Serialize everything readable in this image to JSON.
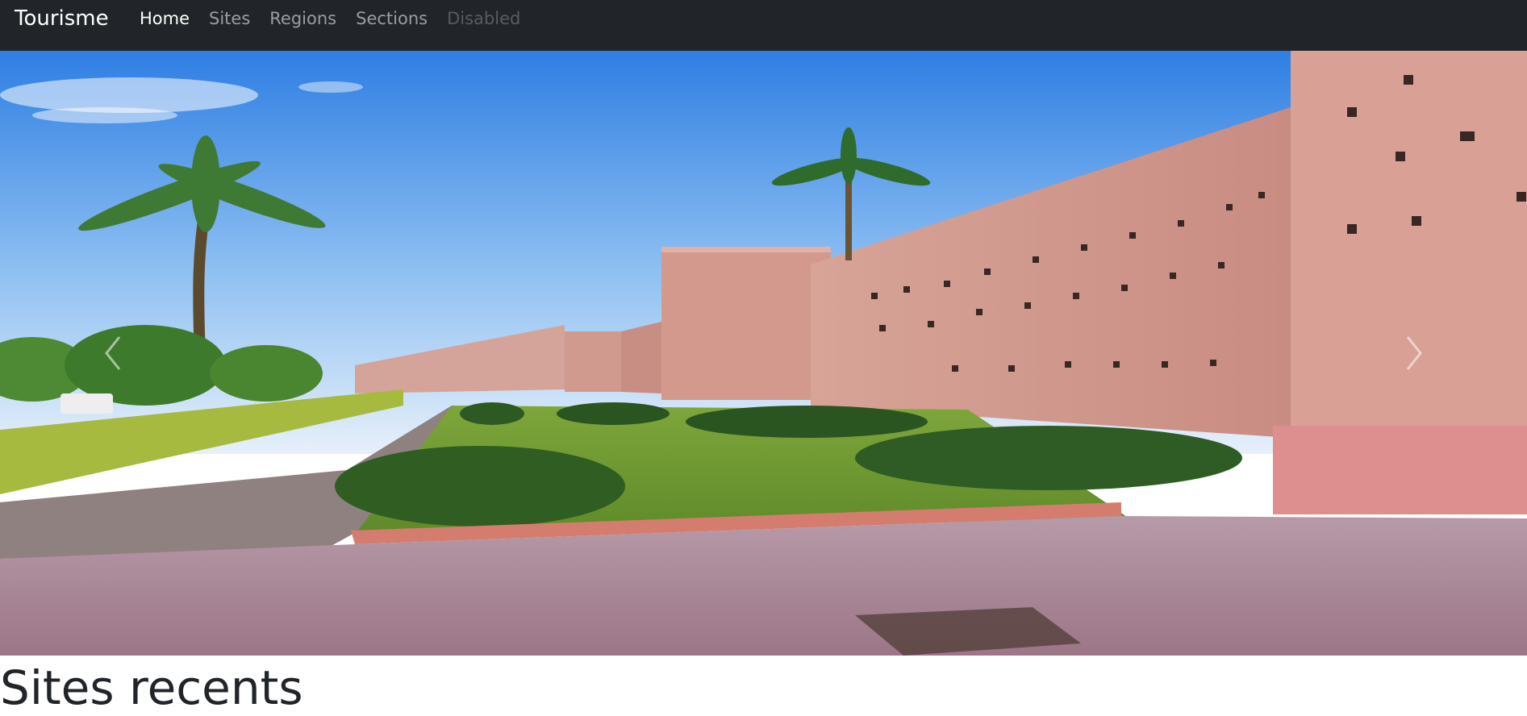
{
  "navbar": {
    "brand": "Tourisme",
    "items": [
      {
        "label": "Home",
        "state": "active"
      },
      {
        "label": "Sites",
        "state": "normal"
      },
      {
        "label": "Regions",
        "state": "normal"
      },
      {
        "label": "Sections",
        "state": "normal"
      },
      {
        "label": "Disabled",
        "state": "disabled"
      }
    ]
  },
  "carousel": {
    "prev_icon": "chevron-left-icon",
    "next_icon": "chevron-right-icon"
  },
  "main": {
    "title": "Sites recents"
  },
  "colors": {
    "navbar_bg": "#212529",
    "sky_top": "#3f86e0",
    "wall": "#d9a196",
    "grass": "#7a9a3a",
    "pavement": "#b38d9a"
  }
}
